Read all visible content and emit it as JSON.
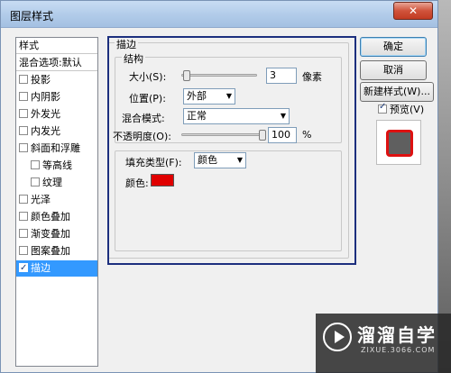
{
  "window": {
    "title": "图层样式",
    "close_glyph": "✕"
  },
  "left_panel": {
    "items": [
      {
        "label": "样式",
        "type": "header"
      },
      {
        "label": "混合选项:默认",
        "type": "header"
      },
      {
        "label": "投影",
        "checked": false
      },
      {
        "label": "内阴影",
        "checked": false
      },
      {
        "label": "外发光",
        "checked": false
      },
      {
        "label": "内发光",
        "checked": false
      },
      {
        "label": "斜面和浮雕",
        "checked": false
      },
      {
        "label": "等高线",
        "checked": false,
        "indent": true
      },
      {
        "label": "纹理",
        "checked": false,
        "indent": true
      },
      {
        "label": "光泽",
        "checked": false
      },
      {
        "label": "颜色叠加",
        "checked": false
      },
      {
        "label": "渐变叠加",
        "checked": false
      },
      {
        "label": "图案叠加",
        "checked": false
      },
      {
        "label": "描边",
        "checked": true,
        "selected": true
      }
    ]
  },
  "stroke": {
    "section_title": "描边",
    "structure_title": "结构",
    "size_label": "大小(S):",
    "size_value": "3",
    "size_unit": "像素",
    "position_label": "位置(P):",
    "position_value": "外部",
    "blend_label": "混合模式:",
    "blend_value": "正常",
    "opacity_label": "不透明度(O):",
    "opacity_value": "100",
    "opacity_unit": "%",
    "fill_type_label": "填充类型(F):",
    "fill_type_value": "颜色",
    "color_label": "颜色:",
    "color_value": "#e00000"
  },
  "buttons": {
    "ok": "确定",
    "cancel": "取消",
    "new_style": "新建样式(W)...",
    "preview_label": "预览(V)",
    "preview_checked": true
  },
  "watermark": {
    "cn": "溜溜自学",
    "en": "ZIXUE.3066.COM"
  }
}
